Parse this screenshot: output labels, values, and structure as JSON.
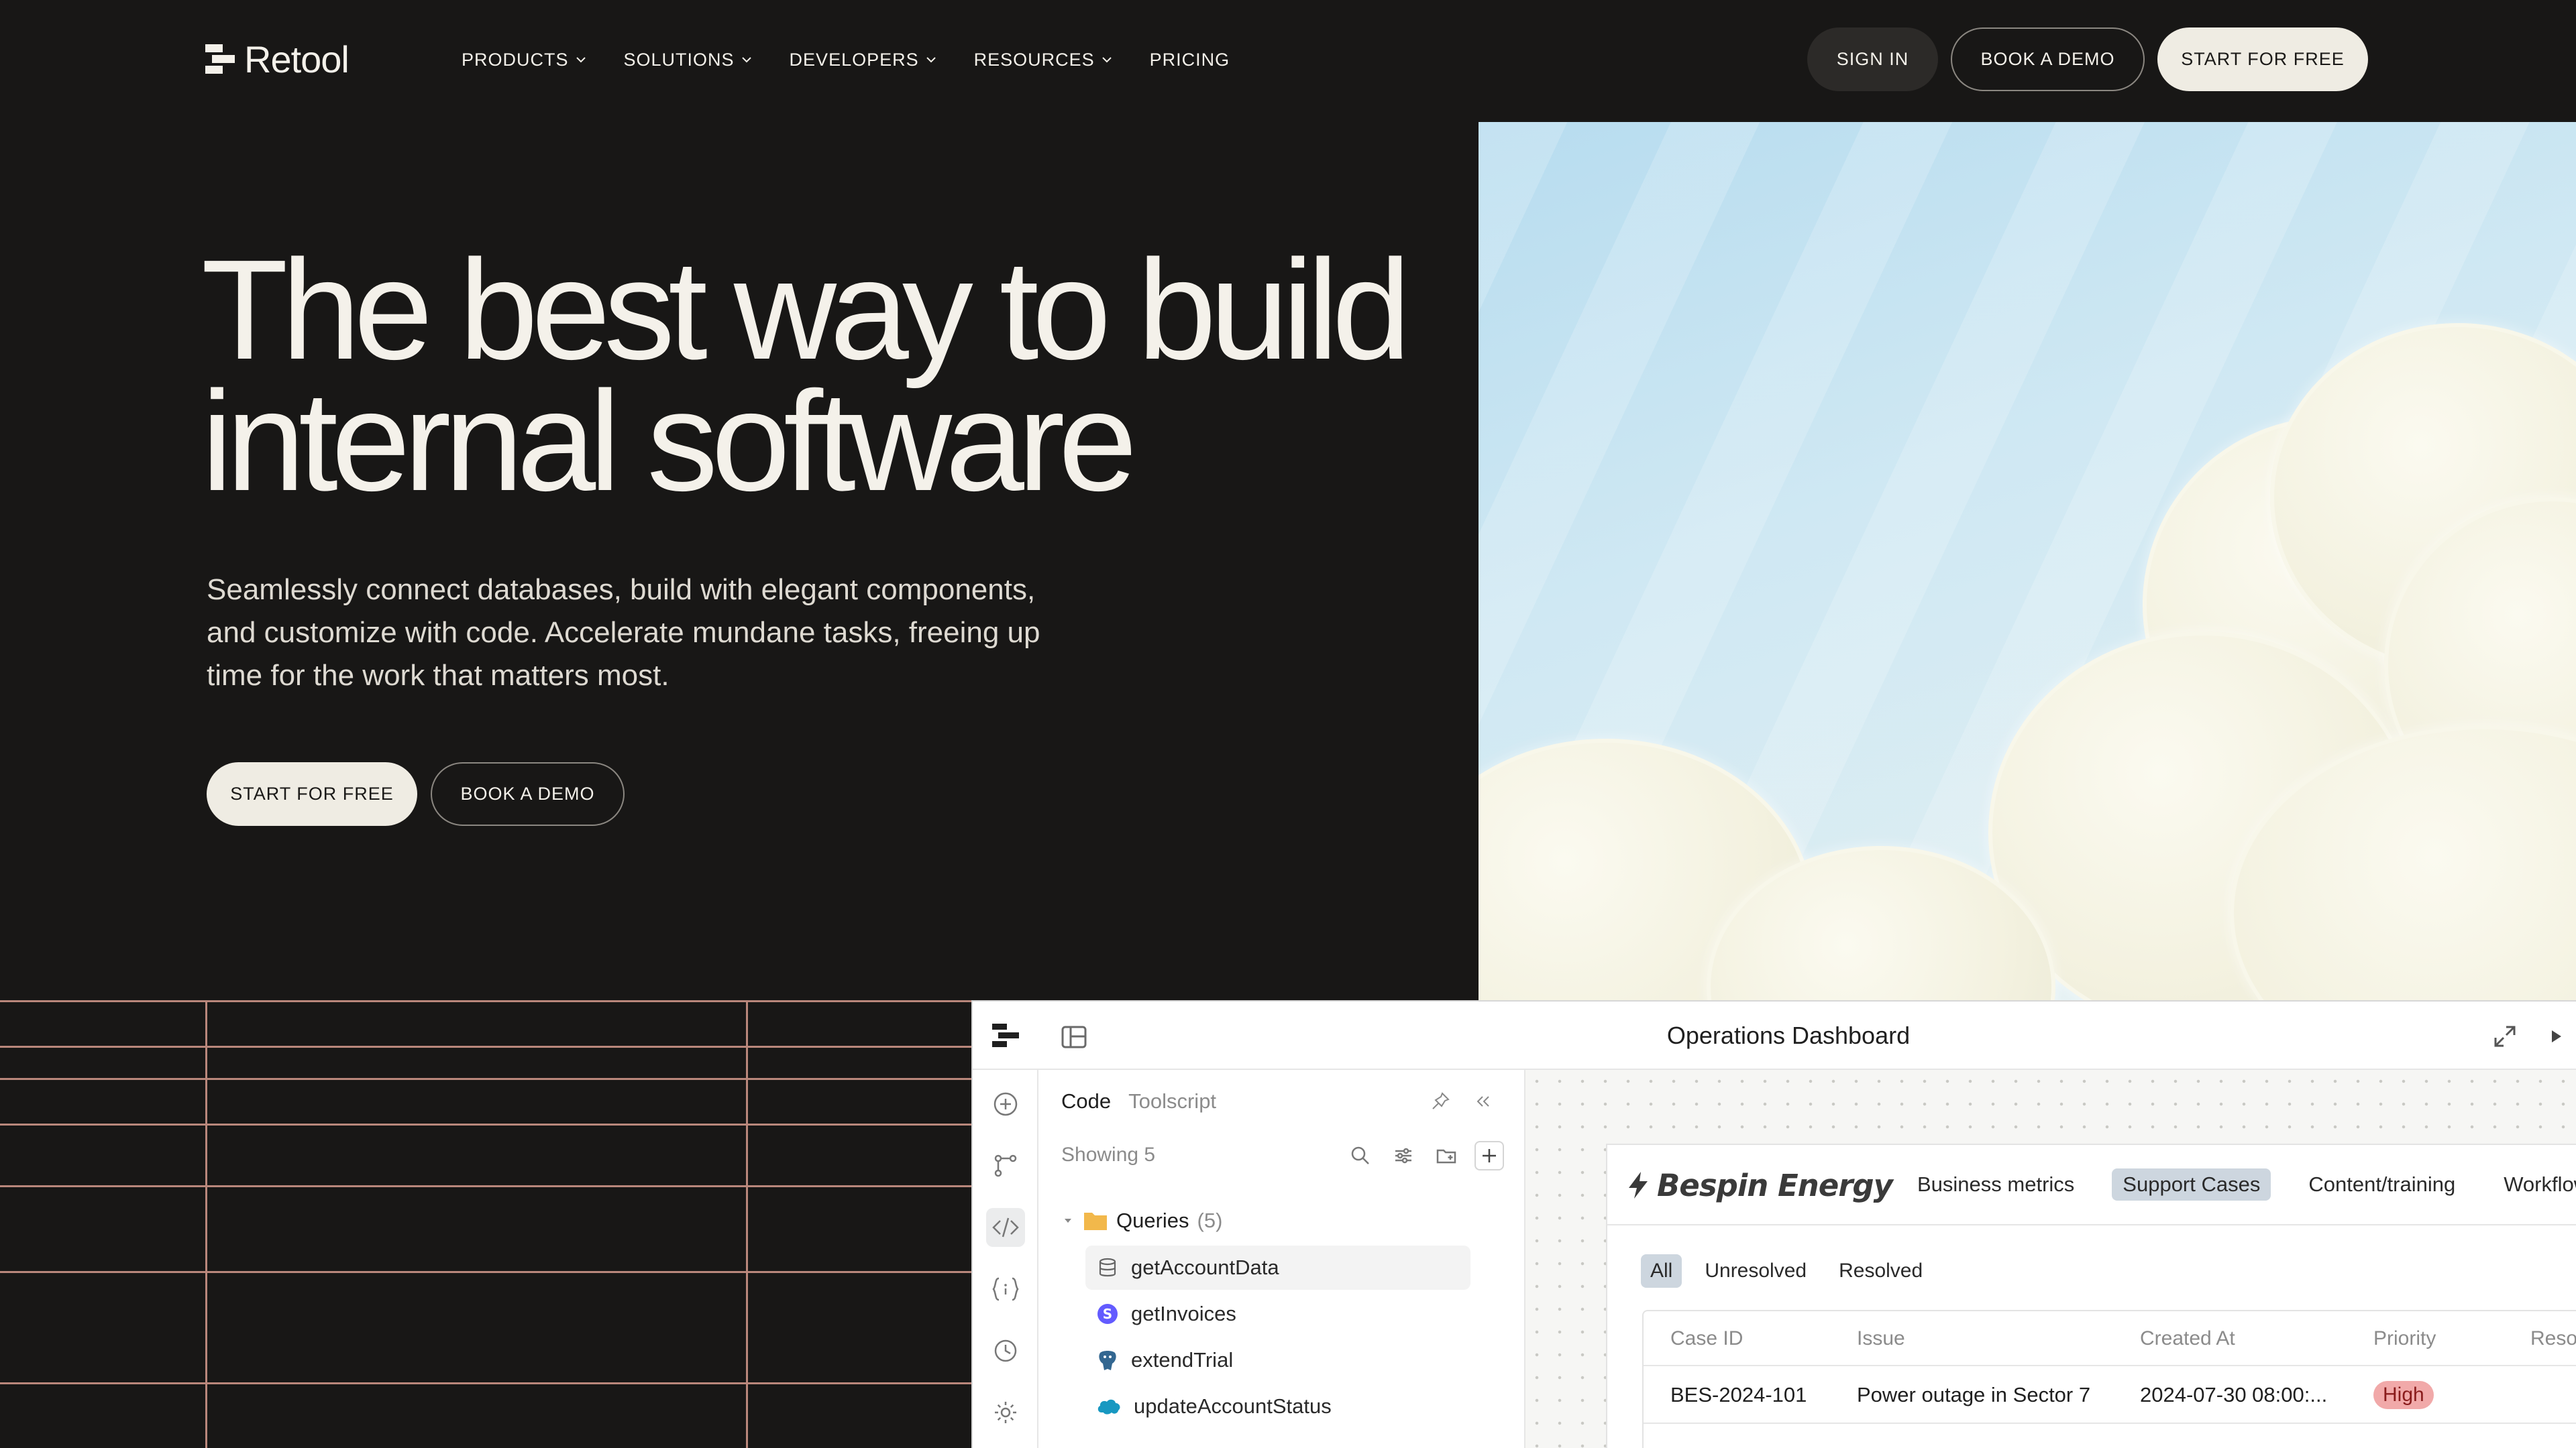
{
  "nav": {
    "logo_text": "Retool",
    "menu": [
      {
        "label": "PRODUCTS",
        "has_dropdown": true
      },
      {
        "label": "SOLUTIONS",
        "has_dropdown": true
      },
      {
        "label": "DEVELOPERS",
        "has_dropdown": true
      },
      {
        "label": "RESOURCES",
        "has_dropdown": true
      },
      {
        "label": "PRICING",
        "has_dropdown": false
      }
    ],
    "sign_in": "SIGN IN",
    "book_demo": "BOOK A DEMO",
    "start_free": "START FOR FREE"
  },
  "hero": {
    "title_line1": "The best way to build",
    "title_line2": "internal software",
    "subtitle_line1": "Seamlessly connect databases, build with elegant components,",
    "subtitle_line2": "and customize with code. Accelerate mundane tasks, freeing up",
    "subtitle_line3": "time for the work that matters most.",
    "cta_primary": "START FOR FREE",
    "cta_secondary": "BOOK A DEMO"
  },
  "app": {
    "title": "Operations Dashboard",
    "panel": {
      "tabs": [
        "Code",
        "Toolscript"
      ],
      "showing": "Showing 5",
      "folder_label": "Queries",
      "folder_count": "(5)",
      "items": [
        {
          "label": "getAccountData",
          "icon": "database-icon"
        },
        {
          "label": "getInvoices",
          "icon": "stripe-icon"
        },
        {
          "label": "extendTrial",
          "icon": "postgres-icon"
        },
        {
          "label": "updateAccountStatus",
          "icon": "salesforce-icon"
        }
      ]
    },
    "dashboard": {
      "brand": "Bespin Energy",
      "nav": [
        "Business metrics",
        "Support Cases",
        "Content/training",
        "Workflow"
      ],
      "nav_selected": "Support Cases",
      "filters": [
        "All",
        "Unresolved",
        "Resolved"
      ],
      "filter_selected": "All",
      "columns": [
        "Case ID",
        "Issue",
        "Created At",
        "Priority",
        "Resolved At"
      ],
      "rows": [
        {
          "case_id": "BES-2024-101",
          "issue": "Power outage in Sector 7",
          "created_at": "2024-07-30 08:00:...",
          "priority": "High",
          "resolved_at": ""
        }
      ]
    }
  },
  "colors": {
    "background": "#181716",
    "cream": "#efece3",
    "grid_line": "#b9877b",
    "badge_high": "#f1a9a9",
    "selected_tab": "#cdd6df"
  }
}
